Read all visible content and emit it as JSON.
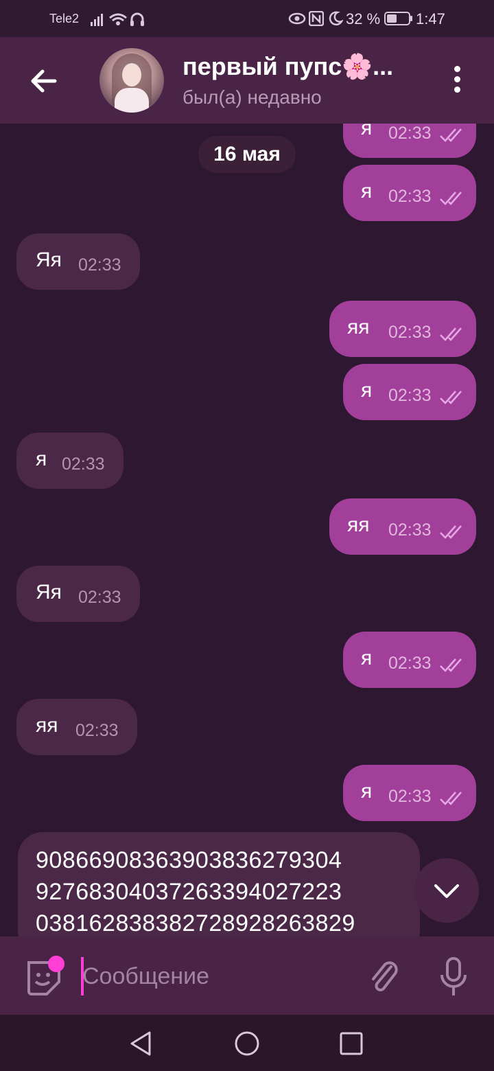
{
  "status_bar": {
    "carrier": "Tele2",
    "battery": "32 %",
    "time": "1:47"
  },
  "header": {
    "title": "первый пупс🌸...",
    "subtitle": "был(а) недавно"
  },
  "chat": {
    "date": "16 мая",
    "messages": [
      {
        "dir": "out",
        "text": "я",
        "time": "02:33"
      },
      {
        "dir": "out",
        "text": "я",
        "time": "02:33"
      },
      {
        "dir": "in",
        "text": "Яя",
        "time": "02:33"
      },
      {
        "dir": "out",
        "text": "яя",
        "time": "02:33"
      },
      {
        "dir": "out",
        "text": "я",
        "time": "02:33"
      },
      {
        "dir": "in",
        "text": "я",
        "time": "02:33"
      },
      {
        "dir": "out",
        "text": "яя",
        "time": "02:33"
      },
      {
        "dir": "in",
        "text": "Яя",
        "time": "02:33"
      },
      {
        "dir": "out",
        "text": "я",
        "time": "02:33"
      },
      {
        "dir": "in",
        "text": "яя",
        "time": "02:33"
      },
      {
        "dir": "out",
        "text": "я",
        "time": "02:33"
      }
    ],
    "long_message_lines": [
      "9086690836390383627930​4",
      "9276830403726339402722​3",
      "0381628383827289282638​29"
    ]
  },
  "input": {
    "placeholder": "Сообщение"
  },
  "icons": {
    "back": "arrow-left-icon",
    "menu": "more-vertical-icon",
    "sticker": "sticker-icon",
    "attach": "paperclip-icon",
    "mic": "microphone-icon",
    "scroll_down": "chevron-down-icon"
  },
  "colors": {
    "background": "#2e1730",
    "header": "#4a2447",
    "outgoing_bubble": "#a23f9a",
    "incoming_bubble": "#4b2748",
    "accent": "#ff3fd5"
  }
}
